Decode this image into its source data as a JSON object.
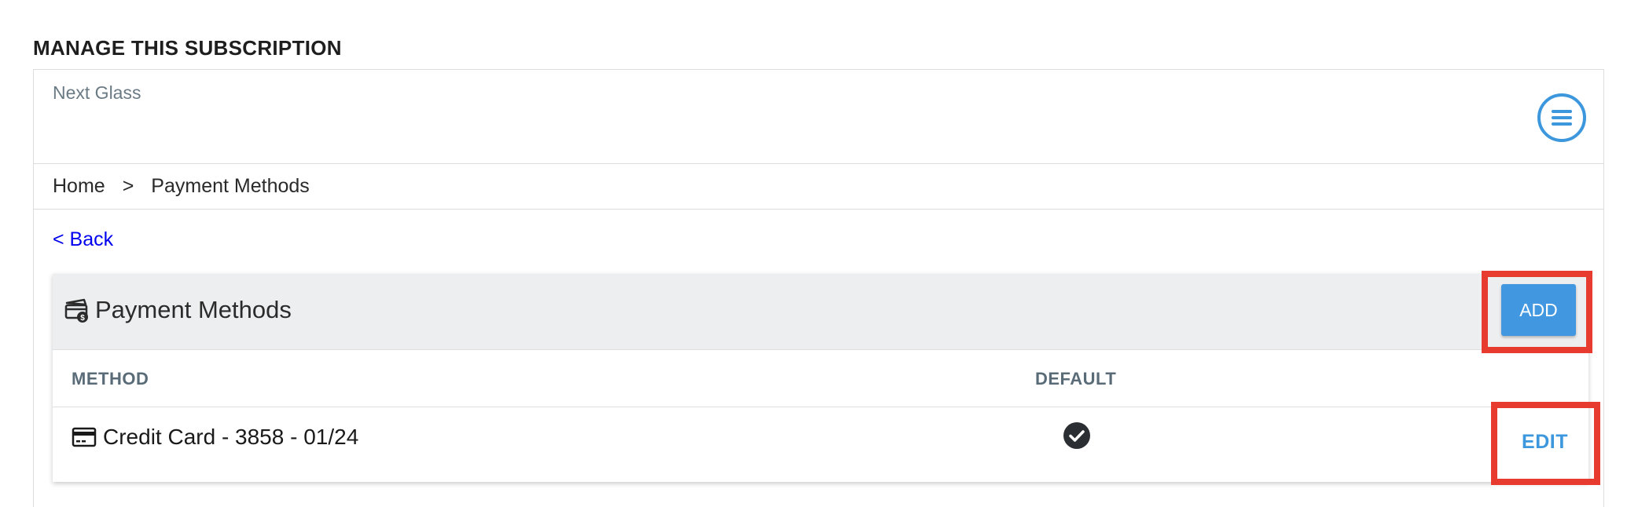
{
  "section": {
    "title": "MANAGE THIS SUBSCRIPTION"
  },
  "brand": {
    "name": "Next Glass",
    "menu_icon": "hamburger-menu-icon"
  },
  "breadcrumb": {
    "items": [
      "Home",
      "Payment Methods"
    ],
    "separator": ">"
  },
  "back_link": {
    "label": "< Back"
  },
  "payment_card": {
    "title": "Payment Methods",
    "title_icon": "payment-stack-icon",
    "add_label": "ADD",
    "columns": {
      "method": "METHOD",
      "default": "DEFAULT"
    },
    "rows": [
      {
        "icon": "credit-card-icon",
        "method": "Credit Card - 3858 - 01/24",
        "is_default": true,
        "edit_label": "EDIT"
      }
    ]
  },
  "colors": {
    "accent": "#4198e0",
    "highlight": "#e63b2e",
    "link": "#0000ee",
    "header_bg": "#edeef0"
  }
}
